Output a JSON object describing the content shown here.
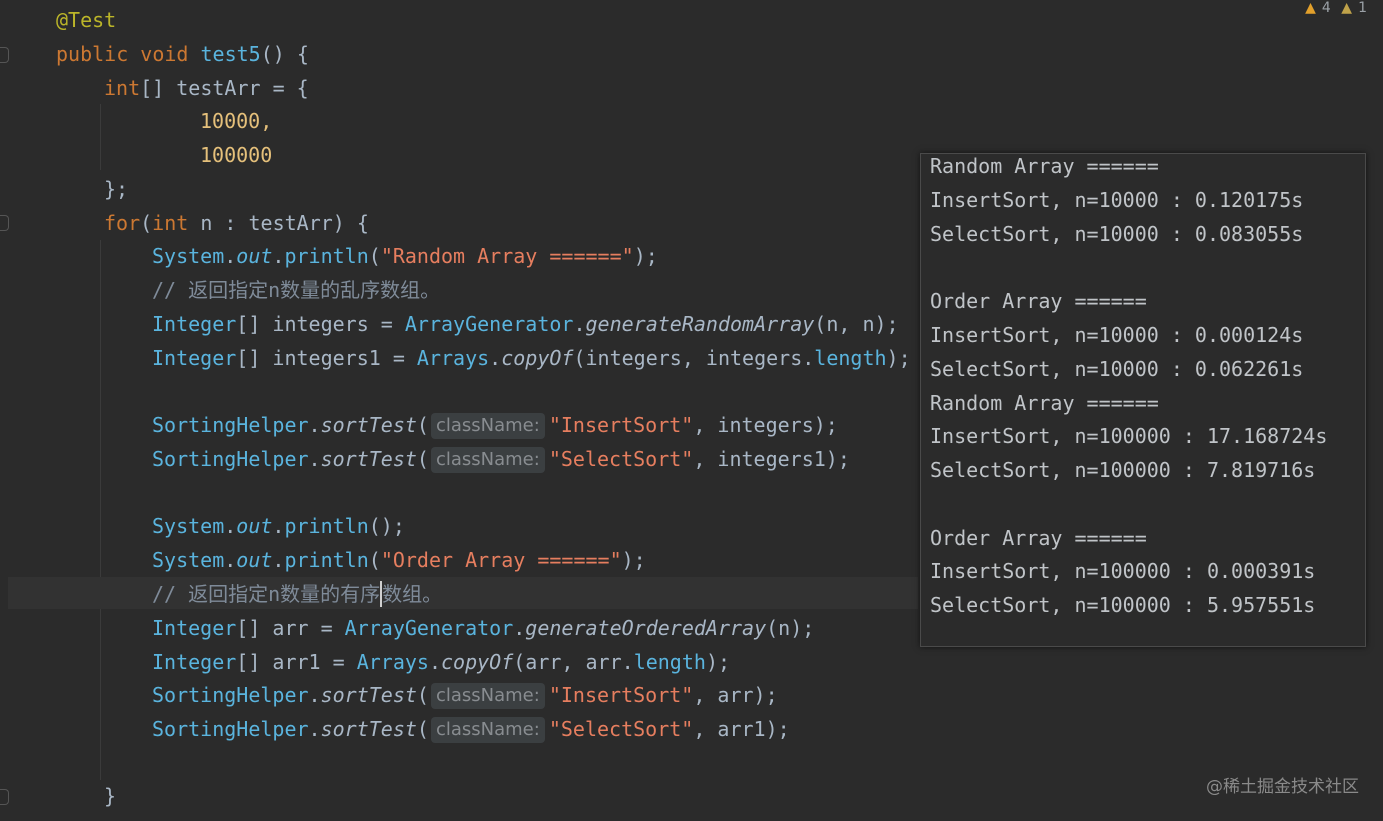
{
  "warnings": {
    "warning_count": "4",
    "weak_warning_count": "1"
  },
  "code": {
    "annotation": "@Test",
    "signature": {
      "kw1": "public",
      "kw2": "void",
      "name": "test5",
      "rest": "() {"
    },
    "arr_decl": {
      "kw": "int",
      "rest": "[] testArr = {"
    },
    "val1": "10000,",
    "val2": "100000",
    "close_arr": "};",
    "for_line": {
      "kw": "for",
      "p1": "(",
      "kw2": "int",
      "rest": " n : testArr) {"
    },
    "println1": {
      "cls": "System",
      "fld": "out",
      "fn": "println",
      "arg": "\"Random Array ======\""
    },
    "comment1": "// 返回指定n数量的乱序数组。",
    "ints_line": {
      "type": "Integer",
      "decl": "[] integers = ",
      "cls": "ArrayGenerator",
      "method": "generateRandomArray",
      "args": "(n, n);"
    },
    "ints1_line": {
      "type": "Integer",
      "decl": "[] integers1 = ",
      "cls": "Arrays",
      "method": "copyOf",
      "args": "(integers, integers.",
      "fld": "length",
      "end": ");"
    },
    "sort1": {
      "cls": "SortingHelper",
      "method": "sortTest",
      "hint": "className:",
      "str": "\"InsertSort\"",
      "rest": ", integers);"
    },
    "sort2": {
      "cls": "SortingHelper",
      "method": "sortTest",
      "hint": "className:",
      "str": "\"SelectSort\"",
      "rest": ", integers1);"
    },
    "println_empty": {
      "cls": "System",
      "fld": "out",
      "fn": "println",
      "args": "();"
    },
    "println2": {
      "cls": "System",
      "fld": "out",
      "fn": "println",
      "arg": "\"Order Array ======\""
    },
    "comment2a": "// 返回指定n数量的有序",
    "comment2b": "数组。",
    "arr_line": {
      "type": "Integer",
      "decl": "[] arr = ",
      "cls": "ArrayGenerator",
      "method": "generateOrderedArray",
      "args": "(n);"
    },
    "arr1_line": {
      "type": "Integer",
      "decl": "[] arr1 = ",
      "cls": "Arrays",
      "method": "copyOf",
      "args": "(arr, arr.",
      "fld": "length",
      "end": ");"
    },
    "sort3": {
      "cls": "SortingHelper",
      "method": "sortTest",
      "hint": "className:",
      "str": "\"InsertSort\"",
      "rest": ", arr);"
    },
    "sort4": {
      "cls": "SortingHelper",
      "method": "sortTest",
      "hint": "className:",
      "str": "\"SelectSort\"",
      "rest": ", arr1);"
    },
    "close_for": "}"
  },
  "console": {
    "lines": [
      "Random Array ======",
      "InsertSort, n=10000 : 0.120175s",
      "SelectSort, n=10000 : 0.083055s",
      "",
      "Order Array ======",
      "InsertSort, n=10000 : 0.000124s",
      "SelectSort, n=10000 : 0.062261s",
      "Random Array ======",
      "InsertSort, n=100000 : 17.168724s",
      "SelectSort, n=100000 : 7.819716s",
      "",
      "Order Array ======",
      "InsertSort, n=100000 : 0.000391s",
      "SelectSort, n=100000 : 5.957551s"
    ]
  },
  "watermark": "@稀土掘金技术社区"
}
